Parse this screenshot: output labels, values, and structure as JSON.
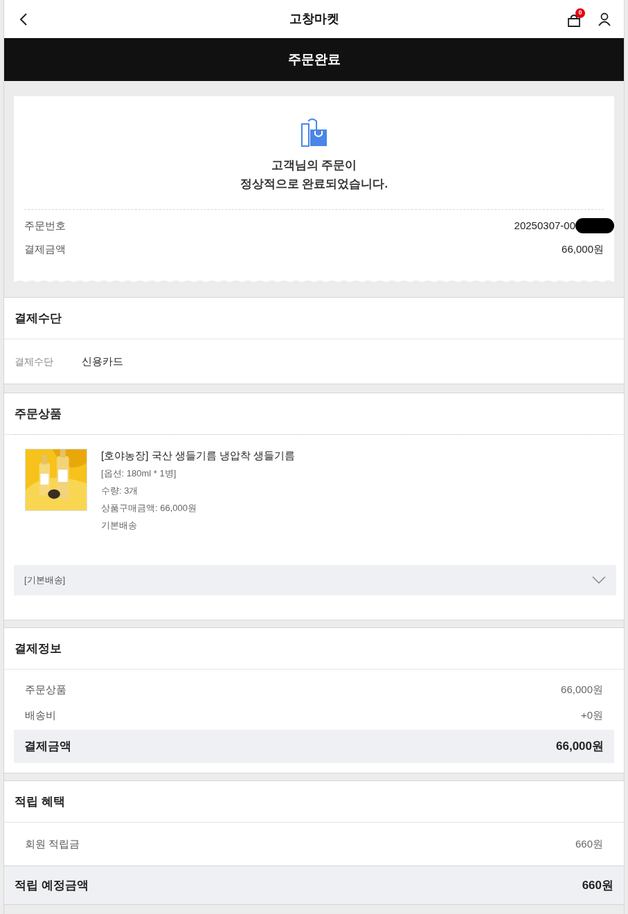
{
  "header": {
    "title": "고창마켓",
    "cart_count": "0"
  },
  "page_title": "주문완료",
  "completion": {
    "message_lines": [
      "고객님의 주문이",
      "정상적으로 완료되었습니다."
    ],
    "rows": [
      {
        "label": "주문번호",
        "value": "20250307-00",
        "redacted": true
      },
      {
        "label": "결제금액",
        "value": "66,000원",
        "redacted": false
      }
    ]
  },
  "payment_method": {
    "title": "결제수단",
    "label": "결제수단",
    "value": "신용카드"
  },
  "ordered_items": {
    "title": "주문상품",
    "items": [
      {
        "name": "[호야농장] 국산 생들기름 냉압착 생들기름",
        "details": [
          "[옵션: 180ml * 1병]",
          "수량: 3개",
          "상품구매금액: 66,000원",
          "기본배송"
        ]
      }
    ],
    "shipping_group": {
      "label": "[기본배송]",
      "expanded": false
    }
  },
  "payment_info": {
    "title": "결제정보",
    "rows": [
      {
        "label": "주문상품",
        "value": "66,000원"
      },
      {
        "label": "배송비",
        "value": "+0원"
      }
    ],
    "total": {
      "label": "결제금액",
      "value": "66,000원"
    }
  },
  "rewards": {
    "title": "적립 혜택",
    "rows": [
      {
        "label": "회원 적립금",
        "value": "660원"
      }
    ],
    "total": {
      "label": "적립 예정금액",
      "value": "660원"
    }
  }
}
